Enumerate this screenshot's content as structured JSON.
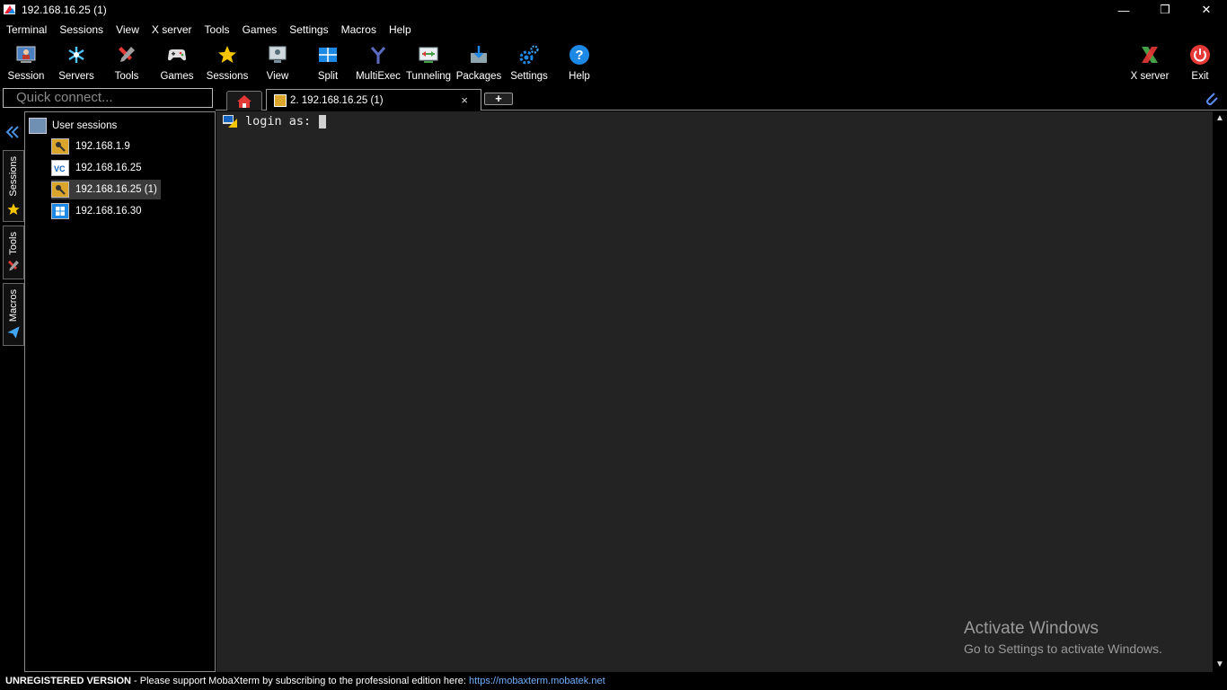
{
  "window": {
    "title": "192.168.16.25 (1)",
    "minimize": "—",
    "restore": "❐",
    "close": "✕"
  },
  "menu": [
    "Terminal",
    "Sessions",
    "View",
    "X server",
    "Tools",
    "Games",
    "Settings",
    "Macros",
    "Help"
  ],
  "toolbar": {
    "session": "Session",
    "servers": "Servers",
    "tools": "Tools",
    "games": "Games",
    "sessions": "Sessions",
    "view": "View",
    "split": "Split",
    "multiexec": "MultiExec",
    "tunneling": "Tunneling",
    "packages": "Packages",
    "settings": "Settings",
    "help": "Help",
    "xserver": "X server",
    "exit": "Exit"
  },
  "quick_connect": {
    "placeholder": "Quick connect..."
  },
  "tabs": {
    "active_label": "2. 192.168.16.25 (1)",
    "close": "×",
    "new": "+"
  },
  "side_tabs": {
    "sessions": "Sessions",
    "tools": "Tools",
    "macros": "Macros"
  },
  "sessions_tree": {
    "root": "User sessions",
    "items": [
      "192.168.1.9",
      "192.168.16.25",
      "192.168.16.25 (1)",
      "192.168.16.30"
    ]
  },
  "terminal": {
    "prompt": "login as:"
  },
  "watermark": {
    "line1": "Activate Windows",
    "line2": "Go to Settings to activate Windows."
  },
  "status": {
    "unregistered": "UNREGISTERED VERSION",
    "message": " -  Please support MobaXterm by subscribing to the professional edition here:  ",
    "link": "https://mobaxterm.mobatek.net"
  },
  "colors": {
    "terminal_bg": "#232323",
    "link": "#6fb0ff",
    "star": "#f5c400",
    "exit_red": "#e53935"
  }
}
